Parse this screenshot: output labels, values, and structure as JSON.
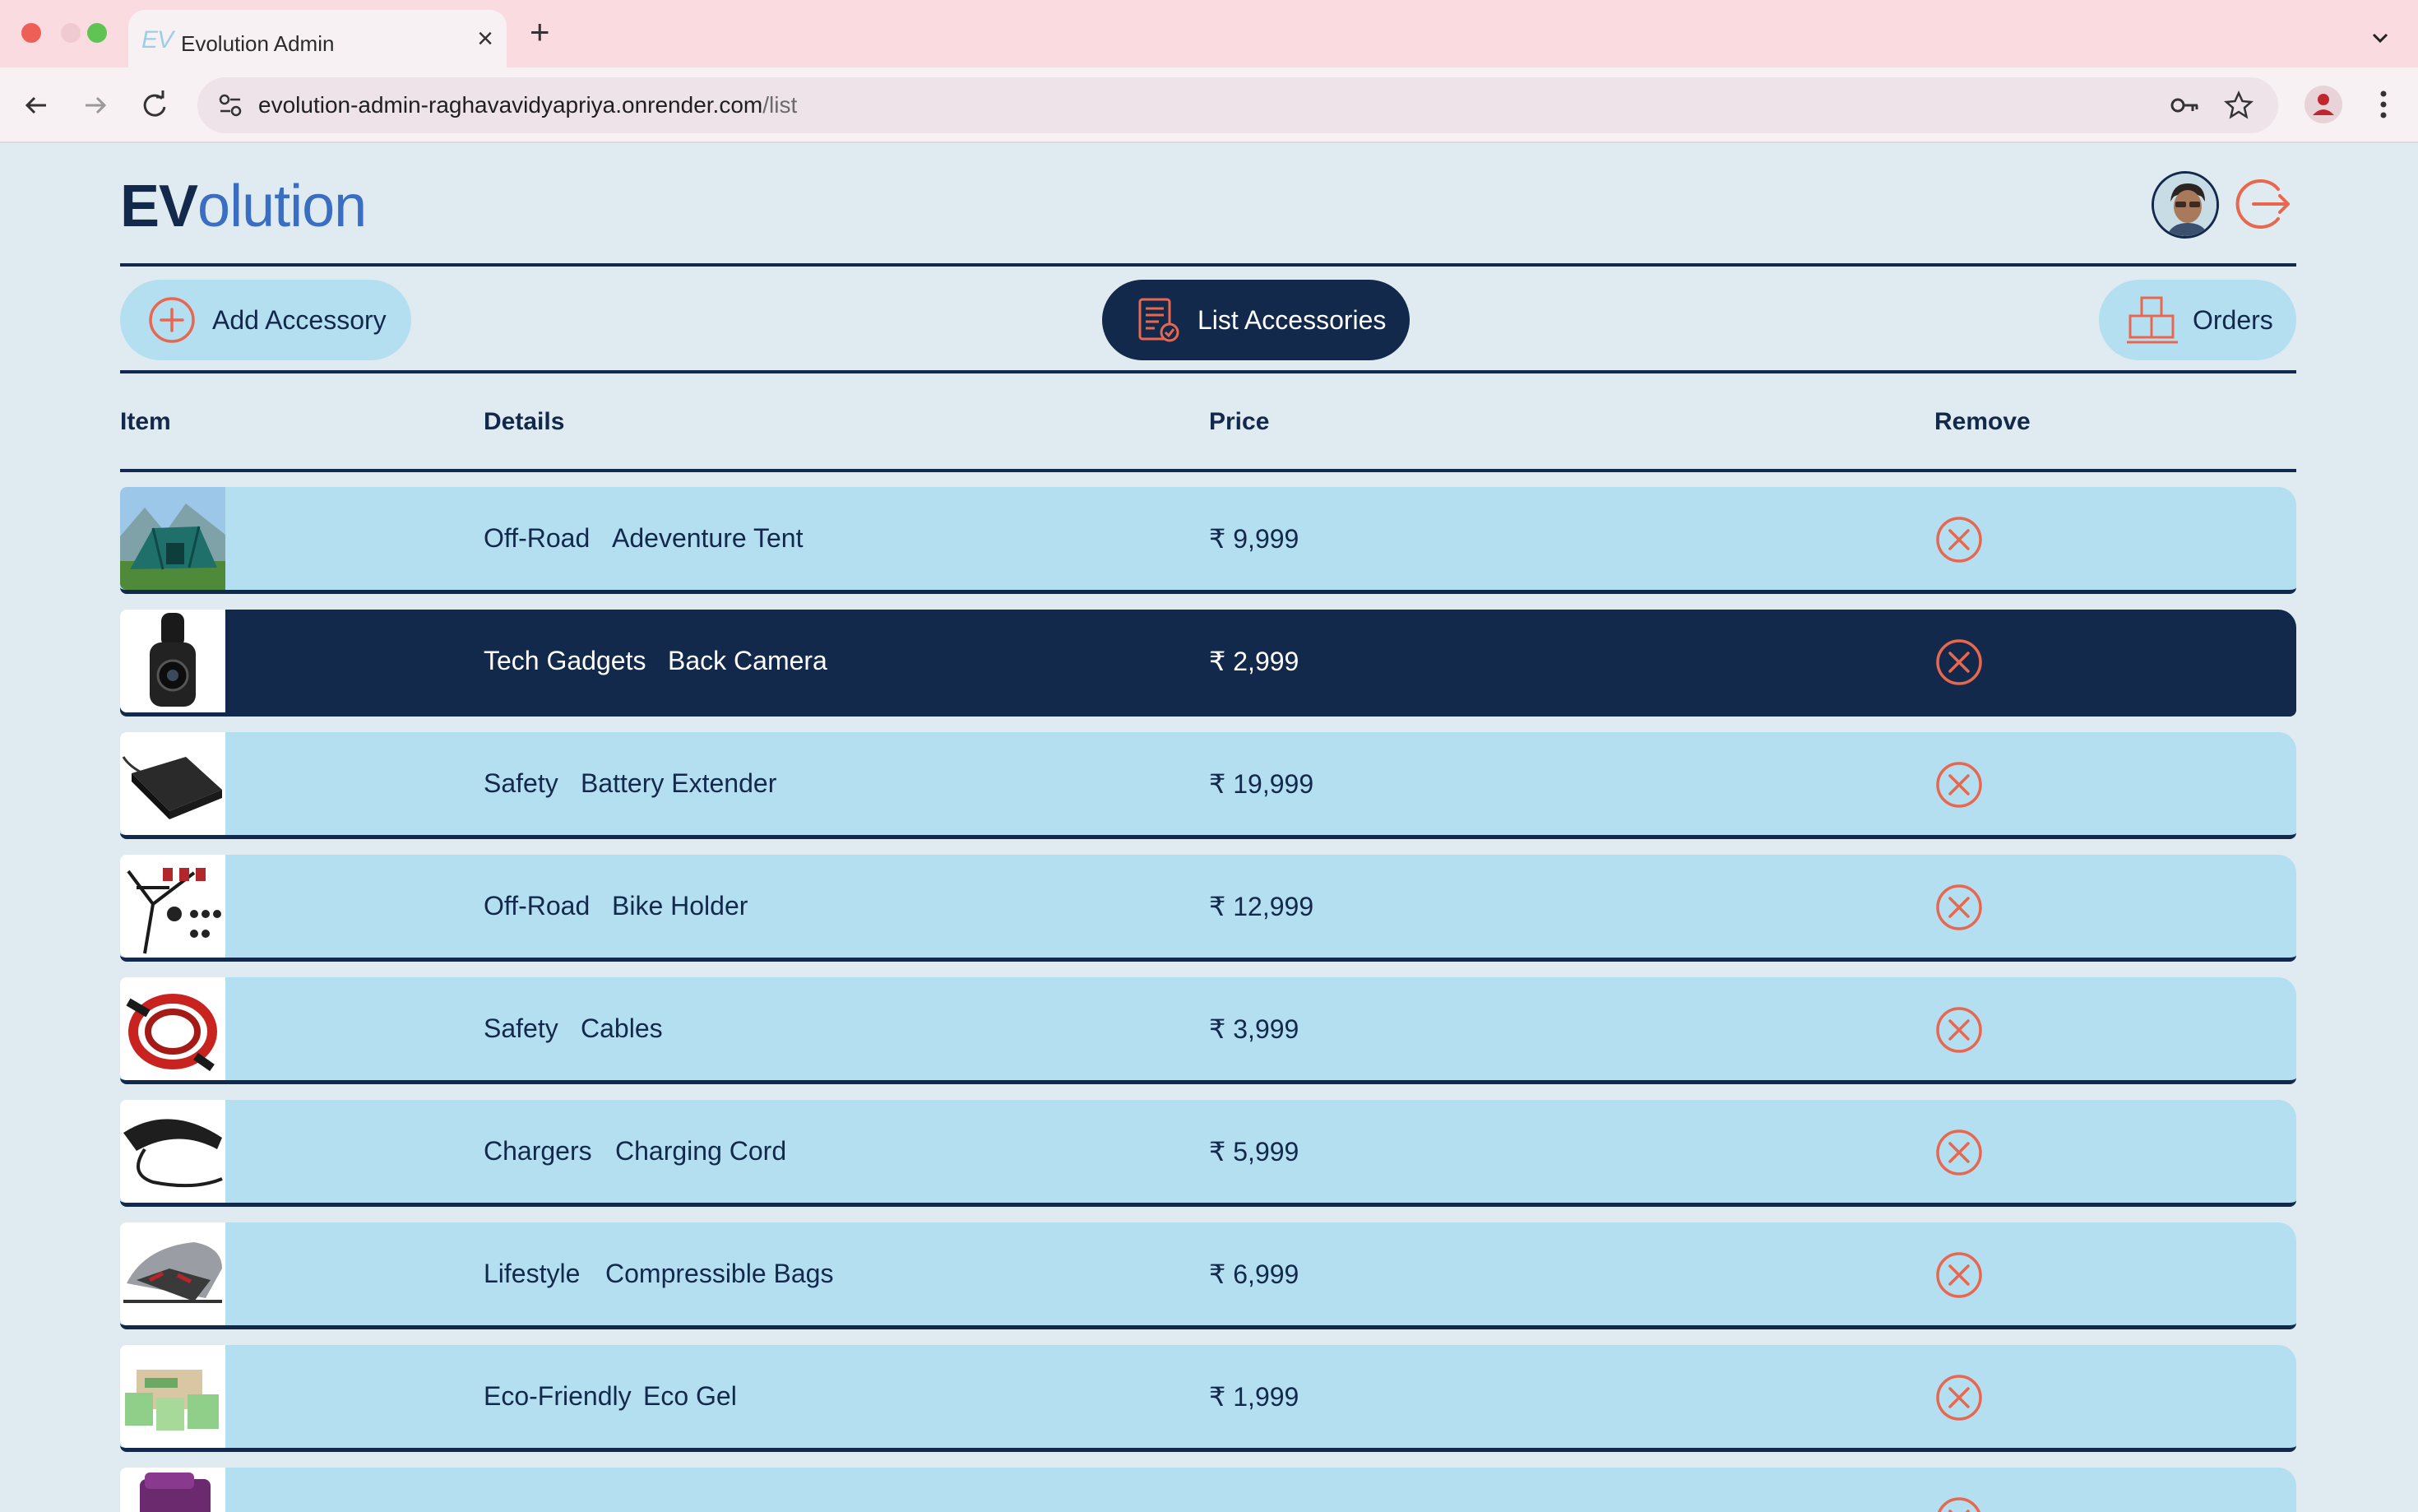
{
  "browser": {
    "tab_title": "Evolution Admin",
    "tab_favicon": "EV",
    "url_domain": "evolution-admin-raghavavidyapriya.onrender.com",
    "url_path": "/list"
  },
  "header": {
    "logo_bold": "EV",
    "logo_rest": "olution"
  },
  "nav": {
    "add_label": "Add Accessory",
    "list_label": "List Accessories",
    "orders_label": "Orders",
    "active": "List Accessories"
  },
  "table": {
    "columns": [
      "Item",
      "Details",
      "Price",
      "Remove"
    ],
    "rows": [
      {
        "category": "Off-Road",
        "name": "Adeventure Tent",
        "price": "₹ 9,999",
        "thumb": "tent"
      },
      {
        "category": "Tech Gadgets",
        "name": "Back Camera",
        "price": "₹ 2,999",
        "thumb": "camera"
      },
      {
        "category": "Safety",
        "name": "Battery Extender",
        "price": "₹ 19,999",
        "thumb": "battery"
      },
      {
        "category": "Off-Road",
        "name": "Bike Holder",
        "price": "₹ 12,999",
        "thumb": "bike-holder"
      },
      {
        "category": "Safety",
        "name": "Cables",
        "price": "₹ 3,999",
        "thumb": "cables"
      },
      {
        "category": "Chargers",
        "name": "Charging Cord",
        "price": "₹ 5,999",
        "thumb": "charger"
      },
      {
        "category": "Lifestyle",
        "name": "Compressible Bags",
        "price": "₹ 6,999",
        "thumb": "roof-box"
      },
      {
        "category": "Eco-Friendly",
        "name": "Eco Gel",
        "price": "₹ 1,999",
        "thumb": "eco-gel"
      }
    ],
    "selected_row_index": 1
  },
  "colors": {
    "navy": "#13294b",
    "row_bg": "#b4dff1",
    "page_bg": "#e0ebf1",
    "remove_icon": "#e8674f",
    "logo_accent": "#3a6ec2"
  }
}
